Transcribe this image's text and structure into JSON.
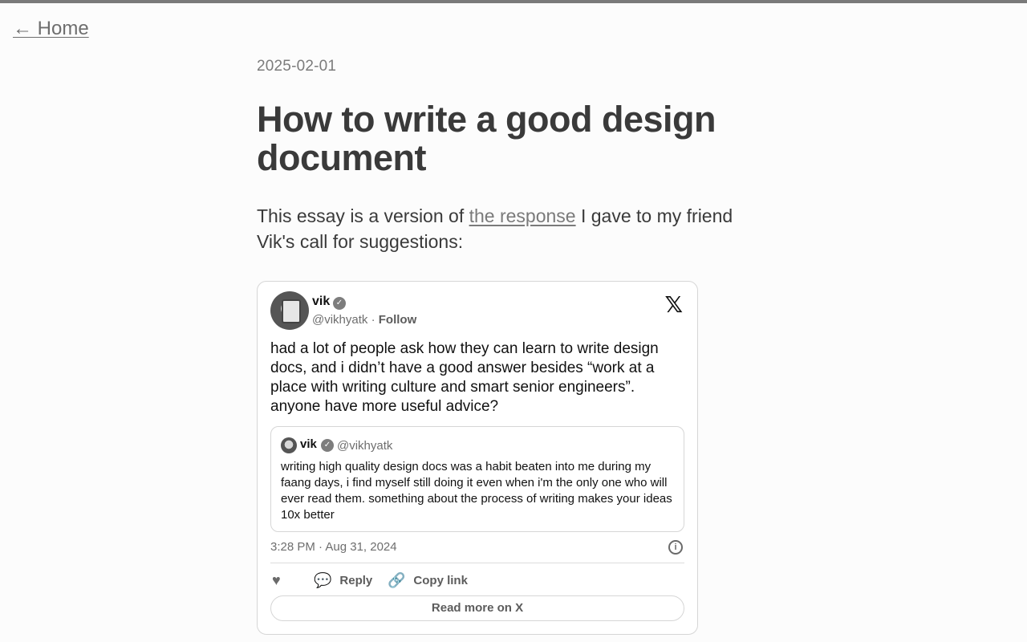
{
  "nav": {
    "home_label": "← Home"
  },
  "post": {
    "date": "2025-02-01",
    "title": "How to write a good design document",
    "intro_before": "This essay is a version of ",
    "intro_link": "the response",
    "intro_after": " I gave to my friend Vik's call for suggestions:"
  },
  "tweet": {
    "name": "vik",
    "handle": "@vikhyatk",
    "separator": " · ",
    "follow_label": "Follow",
    "text": "had a lot of people ask how they can learn to write design docs, and i didn’t have a good answer besides “work at a place with writing culture and smart senior engineers”. anyone have more useful advice?",
    "quote": {
      "name": "vik",
      "handle": "@vikhyatk",
      "text": "writing high quality design docs was a habit beaten into me during my faang days, i find myself still doing it even when i'm the only one who will ever read them. something about the process of writing makes your ideas 10x better"
    },
    "timestamp": "3:28 PM · Aug 31, 2024",
    "actions": {
      "reply_label": "Reply",
      "copy_label": "Copy link"
    },
    "read_more_label": "Read more on X"
  },
  "icons": {
    "verified": "verified-badge-icon",
    "x_logo": "x-logo-icon",
    "info": "info-icon",
    "like": "heart-icon",
    "reply": "speech-bubble-icon",
    "copy": "link-icon"
  }
}
